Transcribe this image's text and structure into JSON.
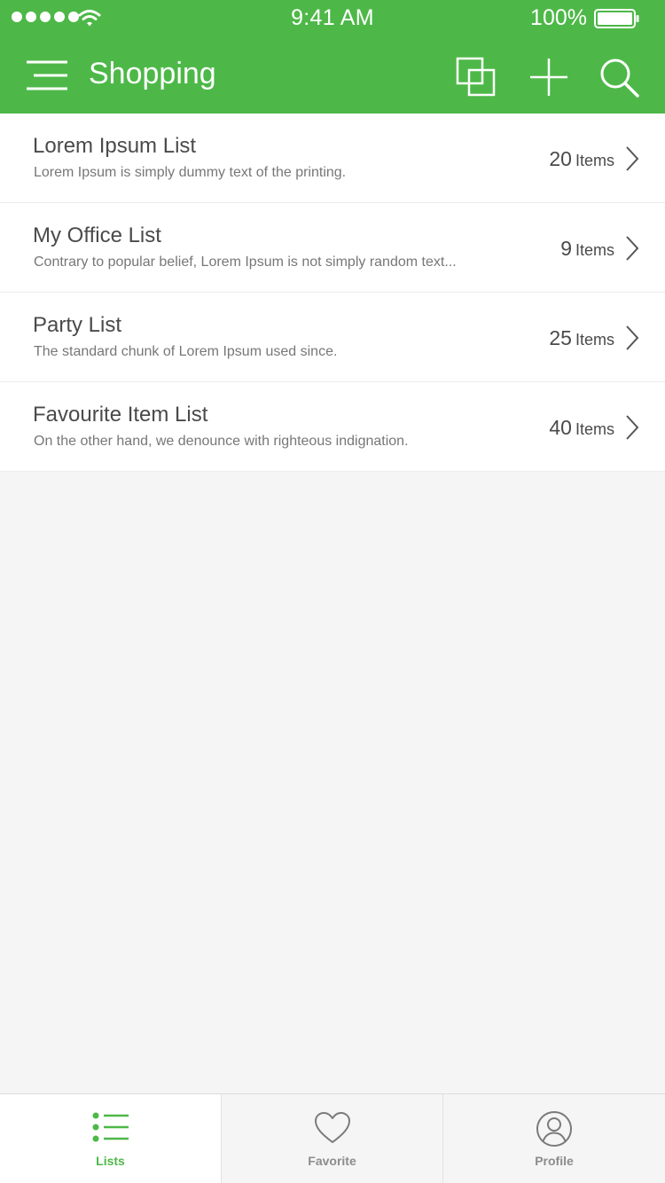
{
  "status_bar": {
    "time": "9:41 AM",
    "battery": "100%"
  },
  "nav": {
    "title": "Shopping",
    "icons": [
      "menu-icon",
      "copy-icon",
      "plus-icon",
      "search-icon"
    ]
  },
  "lists": [
    {
      "title": "Lorem Ipsum List",
      "description": "Lorem Ipsum is simply dummy text of the printing.",
      "count": "20",
      "unit": "Items"
    },
    {
      "title": "My Office List",
      "description": "Contrary to popular belief, Lorem Ipsum is not simply random text...",
      "count": "9",
      "unit": "Items"
    },
    {
      "title": "Party List",
      "description": "The standard chunk of Lorem Ipsum used since.",
      "count": "25",
      "unit": "Items"
    },
    {
      "title": "Favourite Item List",
      "description": "On the other hand, we denounce with righteous indignation.",
      "count": "40",
      "unit": "Items"
    }
  ],
  "tabs": [
    {
      "label": "Lists",
      "icon": "list-icon",
      "active": true
    },
    {
      "label": "Favorite",
      "icon": "heart-icon",
      "active": false
    },
    {
      "label": "Profile",
      "icon": "user-circle-icon",
      "active": false
    }
  ],
  "colors": {
    "brand": "#4db848",
    "background": "#f5f5f5",
    "text": "#4a4a4a",
    "muted": "#777777"
  }
}
